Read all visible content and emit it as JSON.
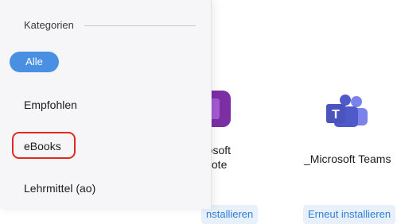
{
  "categories_panel": {
    "title": "Kategorien",
    "items": [
      {
        "label": "Alle",
        "selected": true
      },
      {
        "label": "Empfohlen",
        "selected": false
      },
      {
        "label": "eBooks",
        "selected": false,
        "highlighted": true
      },
      {
        "label": "Lehrmittel (ao)",
        "selected": false
      }
    ]
  },
  "apps": [
    {
      "name": "crosoft\neNote",
      "button_label": "nstallieren",
      "icon": "onenote-icon"
    },
    {
      "name": "_Microsoft Teams",
      "button_label": "Erneut installieren",
      "icon": "teams-icon"
    }
  ],
  "colors": {
    "accent": "#4a90e2",
    "highlight_ring": "#e02a1f",
    "button_bg": "#e8f0fb",
    "button_text": "#2f7ed8"
  }
}
